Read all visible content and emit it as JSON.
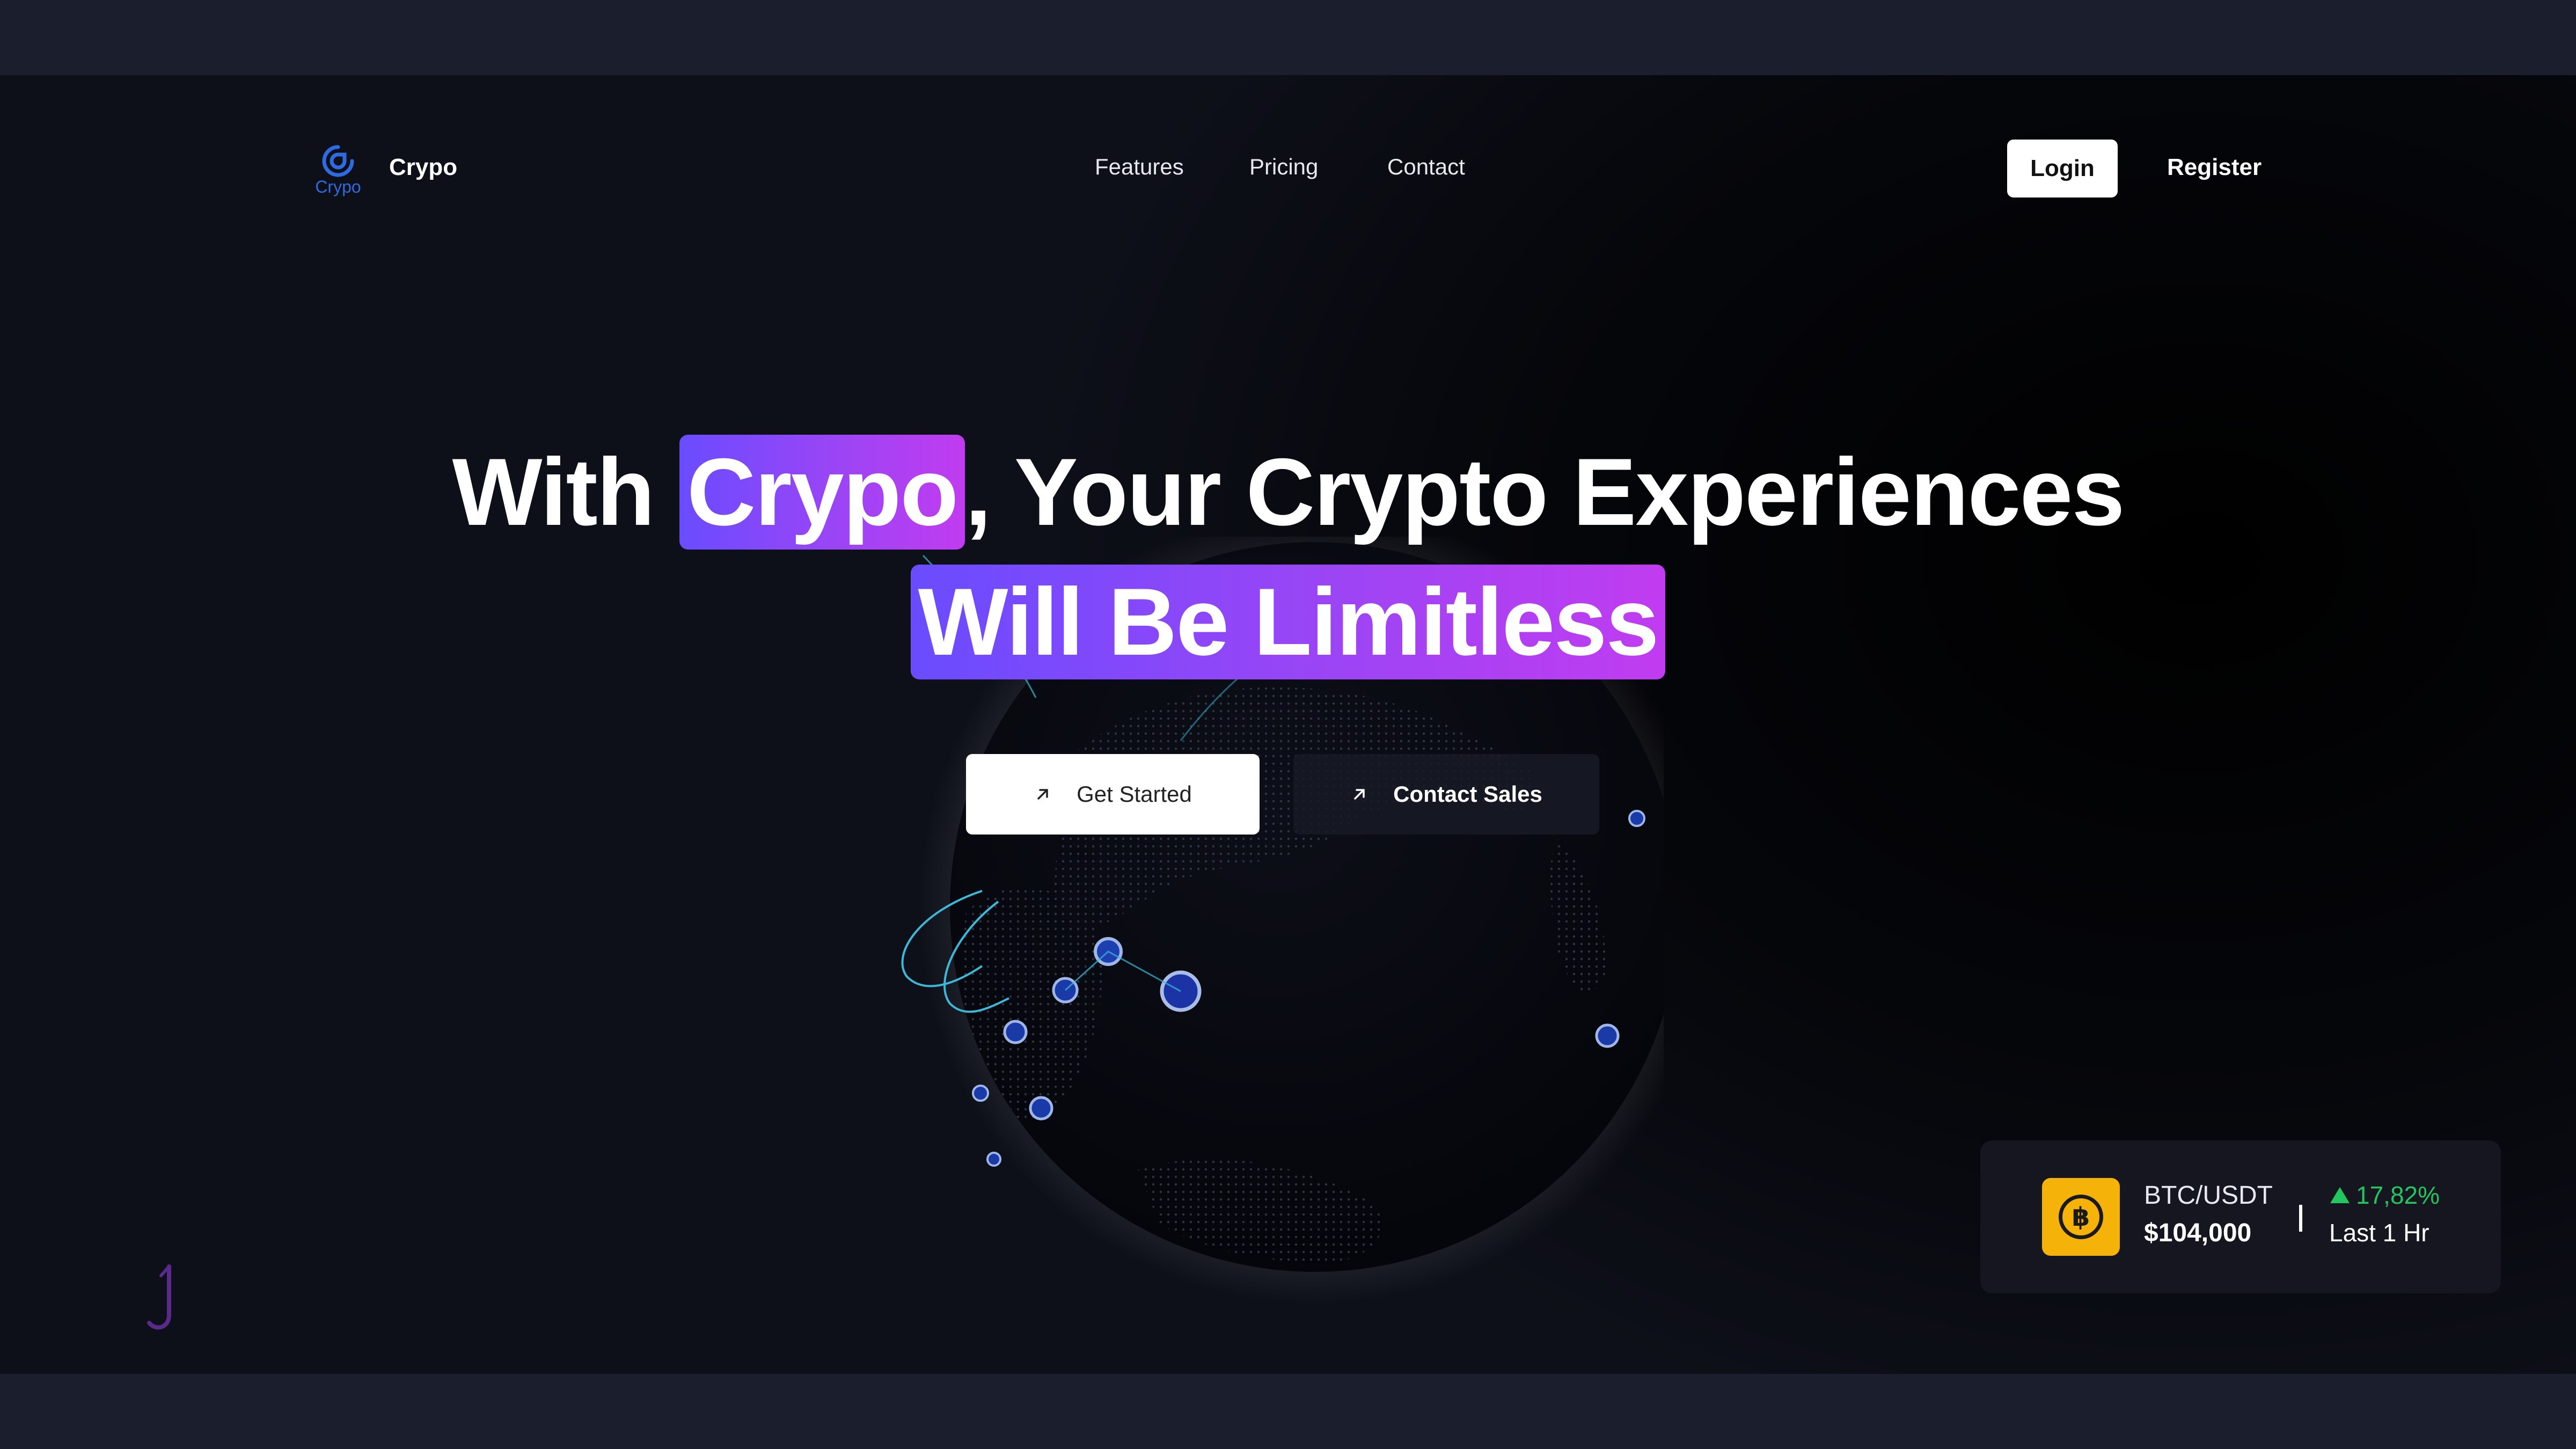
{
  "brand": {
    "name": "Crypo",
    "logo_subtext": "Crypo",
    "logo_color": "#2f6be0"
  },
  "nav": {
    "items": [
      "Features",
      "Pricing",
      "Contact"
    ],
    "login_label": "Login",
    "register_label": "Register"
  },
  "hero": {
    "line1_prefix": "With ",
    "line1_highlight": "Crypo",
    "line1_suffix": ", Your Crypto Experiences",
    "line2_highlight": "Will Be Limitless",
    "highlight_gradient": [
      "#6a4cff",
      "#9b45f5",
      "#c13cf0"
    ]
  },
  "cta": {
    "primary_label": "Get Started",
    "primary_icon": "arrow-up-right-icon",
    "secondary_label": "Contact Sales",
    "secondary_icon": "arrow-up-right-icon"
  },
  "ticker": {
    "coin_icon": "bitcoin-icon",
    "pair": "BTC/USDT",
    "price": "$104,000",
    "change": "17,82%",
    "change_direction": "up",
    "change_color": "#22c55e",
    "period": "Last 1 Hr",
    "coin_color": "#f5b30a"
  },
  "colors": {
    "page_background": "#000000",
    "outer_background": "#1b1e2d"
  }
}
